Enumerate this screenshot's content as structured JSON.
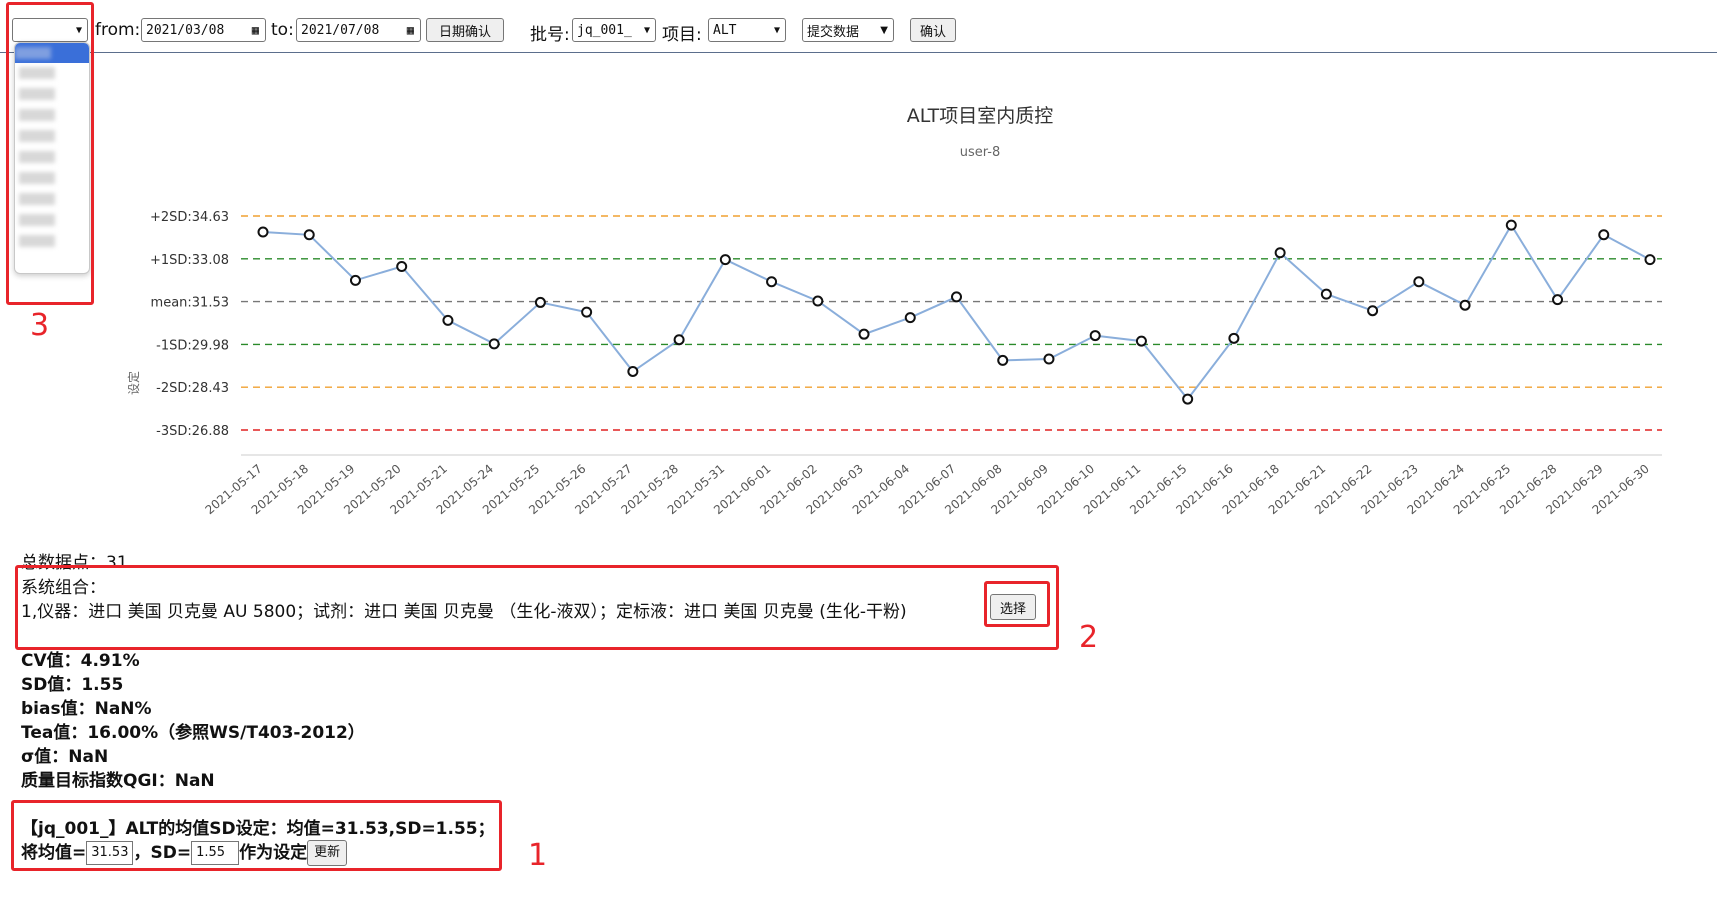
{
  "toolbar": {
    "hospital_select_value": "",
    "from_label": "from:",
    "from_value": "2021/03/08",
    "to_label": "to:",
    "to_value": "2021/07/08",
    "date_confirm": "日期确认",
    "batch_label": "批号:",
    "batch_value": "jq_001_",
    "item_label": "项目:",
    "item_value": "ALT",
    "submit_select": "提交数据",
    "confirm": "确认"
  },
  "dropdown": {
    "items": [
      "",
      "",
      "",
      "",
      "",
      "",
      "",
      "",
      "",
      "",
      ""
    ]
  },
  "chart_data": {
    "type": "line",
    "title": "ALT项目室内质控",
    "subtitle": "user-8",
    "ylabel": "设定",
    "ylim": [
      26.88,
      34.63
    ],
    "reference_lines": [
      {
        "label": "+2SD:34.63",
        "value": 34.63,
        "color": "#f0a030"
      },
      {
        "label": "+1SD:33.08",
        "value": 33.08,
        "color": "#2a8a2a"
      },
      {
        "label": "mean:31.53",
        "value": 31.53,
        "color": "#777777"
      },
      {
        "label": "-1SD:29.98",
        "value": 29.98,
        "color": "#2a8a2a"
      },
      {
        "label": "-2SD:28.43",
        "value": 28.43,
        "color": "#f0a030"
      },
      {
        "label": "-3SD:26.88",
        "value": 26.88,
        "color": "#e02020"
      }
    ],
    "categories": [
      "2021-05-17",
      "2021-05-18",
      "2021-05-19",
      "2021-05-20",
      "2021-05-21",
      "2021-05-24",
      "2021-05-25",
      "2021-05-26",
      "2021-05-27",
      "2021-05-28",
      "2021-05-31",
      "2021-06-01",
      "2021-06-02",
      "2021-06-03",
      "2021-06-04",
      "2021-06-07",
      "2021-06-08",
      "2021-06-09",
      "2021-06-10",
      "2021-06-11",
      "2021-06-15",
      "2021-06-16",
      "2021-06-18",
      "2021-06-21",
      "2021-06-22",
      "2021-06-23",
      "2021-06-24",
      "2021-06-25",
      "2021-06-28",
      "2021-06-29",
      "2021-06-30"
    ],
    "series": [
      {
        "values": [
          34.05,
          33.95,
          32.3,
          32.8,
          30.85,
          30.0,
          31.5,
          31.15,
          29.0,
          30.15,
          33.05,
          32.25,
          31.55,
          30.35,
          30.95,
          31.7,
          29.4,
          29.45,
          30.3,
          30.1,
          28.0,
          30.2,
          33.3,
          31.8,
          31.2,
          32.25,
          31.4,
          34.3,
          31.6,
          33.95,
          33.05
        ]
      }
    ],
    "line_color": "#8aaedb"
  },
  "stats": {
    "total_points": "总数据点：31",
    "system_combo_label": "系统组合：",
    "system_combo_text": "1,仪器：进口 美国 贝克曼 AU 5800；试剂：进口 美国 贝克曼 （生化-液双）；定标液：进口 美国 贝克曼 (生化-干粉)",
    "choose_button": "选择",
    "cv": "CV值：4.91%",
    "sd": "SD值：1.55",
    "bias": "bias值：NaN%",
    "tea": "Tea值：16.00%（参照WS/T403-2012）",
    "sigma": "σ值：NaN",
    "qgi": "质量目标指数QGI：NaN"
  },
  "setting": {
    "line1": "【jq_001_】ALT的均值SD设定：均值=31.53,SD=1.55；",
    "mean_prefix": "将均值=",
    "mean_value": "31.53",
    "sd_prefix": "，SD=",
    "sd_value": "1.55",
    "suffix": "作为设定",
    "update_button": "更新"
  },
  "annotations": {
    "n1": "1",
    "n2": "2",
    "n3": "3"
  }
}
